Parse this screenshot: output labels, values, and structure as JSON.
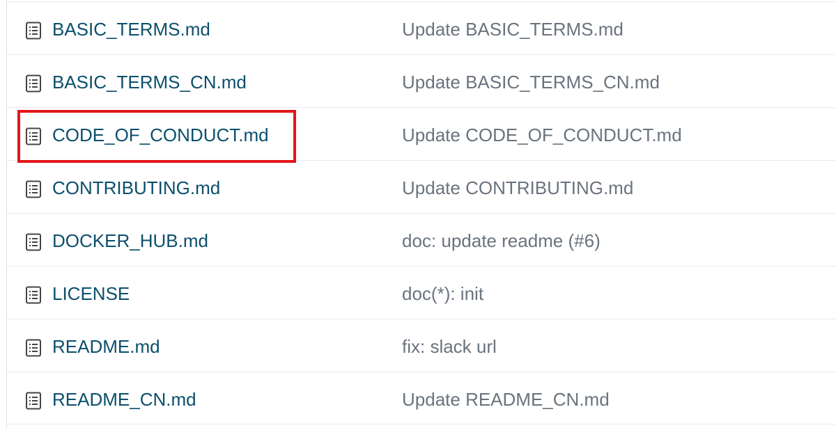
{
  "files": [
    {
      "name": "BASIC_TERMS.md",
      "commit": "Update BASIC_TERMS.md",
      "icon": "file-text-icon"
    },
    {
      "name": "BASIC_TERMS_CN.md",
      "commit": "Update BASIC_TERMS_CN.md",
      "icon": "file-text-icon"
    },
    {
      "name": "CODE_OF_CONDUCT.md",
      "commit": "Update CODE_OF_CONDUCT.md",
      "icon": "file-text-icon"
    },
    {
      "name": "CONTRIBUTING.md",
      "commit": "Update CONTRIBUTING.md",
      "icon": "file-text-icon"
    },
    {
      "name": "DOCKER_HUB.md",
      "commit": "doc: update readme (#6)",
      "icon": "file-text-icon"
    },
    {
      "name": "LICENSE",
      "commit": "doc(*): init",
      "icon": "file-text-icon"
    },
    {
      "name": "README.md",
      "commit": "fix: slack url",
      "icon": "file-text-icon"
    },
    {
      "name": "README_CN.md",
      "commit": "Update README_CN.md",
      "icon": "file-text-icon"
    }
  ],
  "highlighted_file": "CODE_OF_CONDUCT.md",
  "colors": {
    "file_link": "#0b4f6c",
    "commit_text": "#6a737d",
    "highlight": "#e3161b",
    "divider": "#e8eaed"
  }
}
